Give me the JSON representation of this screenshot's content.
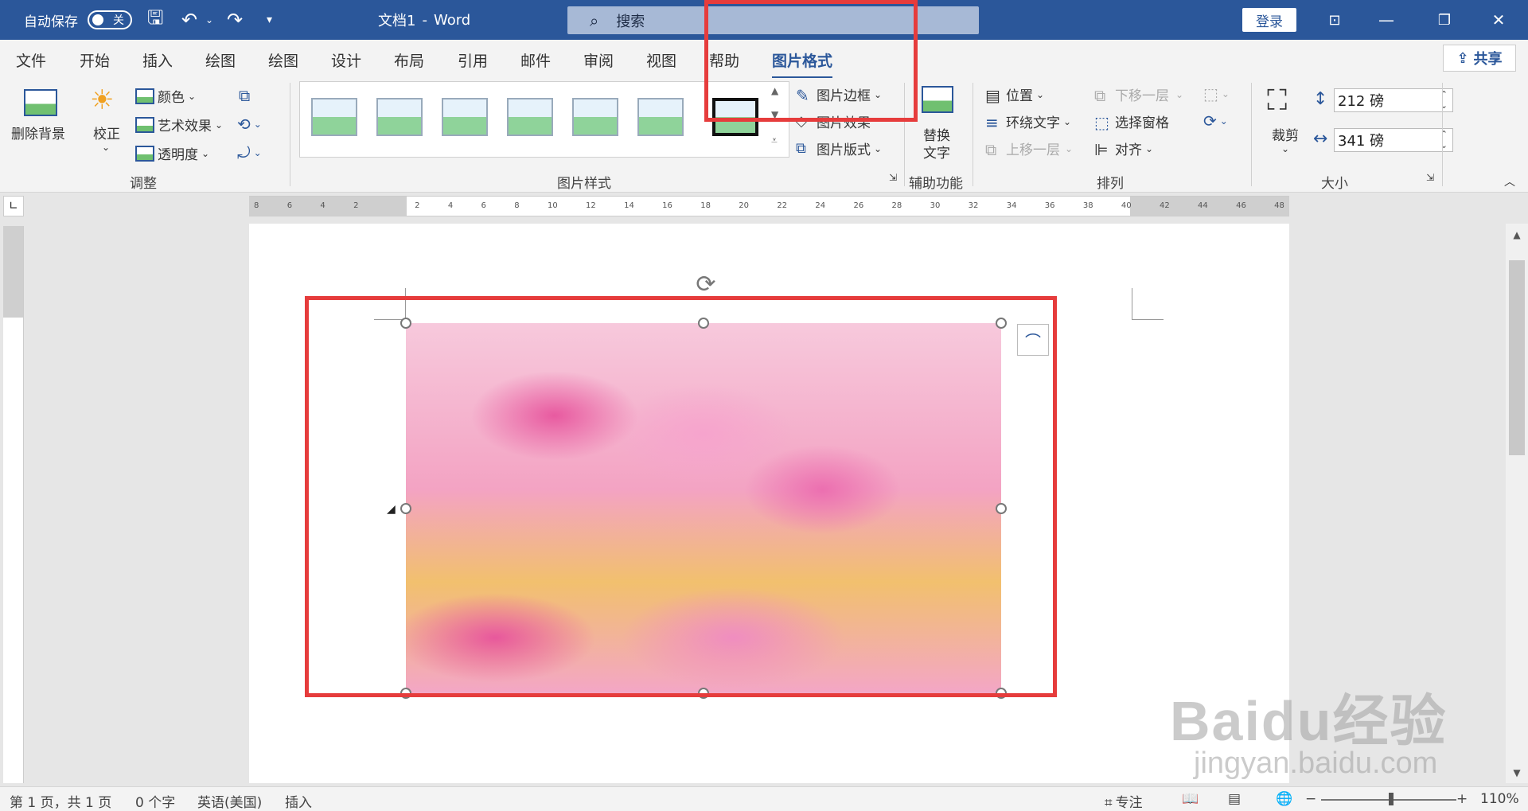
{
  "titlebar": {
    "autosave_label": "自动保存",
    "autosave_state": "关",
    "doc_title": "文档1",
    "app_separator": "-",
    "app_name": "Word",
    "search_placeholder": "搜索",
    "login_label": "登录"
  },
  "tabs": [
    {
      "label": "文件"
    },
    {
      "label": "开始"
    },
    {
      "label": "插入"
    },
    {
      "label": "绘图"
    },
    {
      "label": "绘图"
    },
    {
      "label": "设计"
    },
    {
      "label": "布局"
    },
    {
      "label": "引用"
    },
    {
      "label": "邮件"
    },
    {
      "label": "审阅"
    },
    {
      "label": "视图"
    },
    {
      "label": "帮助"
    },
    {
      "label": "图片格式"
    }
  ],
  "share_label": "共享",
  "ribbon": {
    "remove_bg": "删除背景",
    "corrections": "校正",
    "color": "颜色",
    "artistic": "艺术效果",
    "transparency": "透明度",
    "group_adjust": "调整",
    "picture_border": "图片边框",
    "picture_effects": "图片效果",
    "picture_layout": "图片版式",
    "group_styles": "图片样式",
    "alt_text_line1": "替换",
    "alt_text_line2": "文字",
    "group_accessibility": "辅助功能",
    "position": "位置",
    "wrap_text": "环绕文字",
    "bring_forward": "上移一层",
    "send_backward": "下移一层",
    "selection_pane": "选择窗格",
    "align": "对齐",
    "group_arrange": "排列",
    "crop": "裁剪",
    "height_value": "212 磅",
    "width_value": "341 磅",
    "group_size": "大小"
  },
  "ruler": {
    "h_labels": [
      "8",
      "6",
      "4",
      "2",
      "",
      "2",
      "4",
      "6",
      "8",
      "10",
      "12",
      "14",
      "16",
      "18",
      "20",
      "22",
      "24",
      "26",
      "28",
      "30",
      "32",
      "34",
      "36",
      "38",
      "40",
      "42",
      "44",
      "46",
      "48"
    ]
  },
  "watermark": {
    "brand": "Baidu经验",
    "url": "jingyan.baidu.com"
  },
  "status": {
    "page": "第 1 页，共 1 页",
    "words": "0 个字",
    "language": "英语(美国)",
    "mode": "插入",
    "focus": "专注",
    "zoom": "110%"
  }
}
